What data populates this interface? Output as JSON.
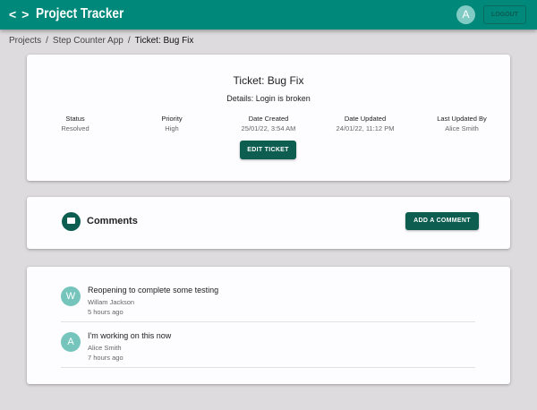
{
  "header": {
    "title": "Project Tracker",
    "avatar_initial": "A",
    "logout_label": "LOGOUT",
    "logo_icon": "code-icon",
    "color": "#00897b"
  },
  "breadcrumb": [
    "Projects",
    "Step Counter App",
    "Ticket: Bug Fix"
  ],
  "ticket": {
    "title": "Ticket: Bug Fix",
    "details": "Details: Login is broken",
    "fields": [
      {
        "label": "Status",
        "value": "Resolved"
      },
      {
        "label": "Priority",
        "value": "High"
      },
      {
        "label": "Date Created",
        "value": "25/01/22, 3:54 AM"
      },
      {
        "label": "Date Updated",
        "value": "24/01/22, 11:12 PM"
      },
      {
        "label": "Last Updated By",
        "value": "Alice Smith"
      }
    ],
    "edit_label": "EDIT TICKET"
  },
  "comments_header": {
    "label": "Comments",
    "icon": "comment-icon",
    "add_label": "ADD A COMMENT"
  },
  "comments": [
    {
      "initial": "W",
      "text": "Reopening to complete some testing",
      "author": "Willam Jackson",
      "time": "5 hours ago"
    },
    {
      "initial": "A",
      "text": "I'm working on this now",
      "author": "Alice Smith",
      "time": "7 hours ago"
    }
  ]
}
